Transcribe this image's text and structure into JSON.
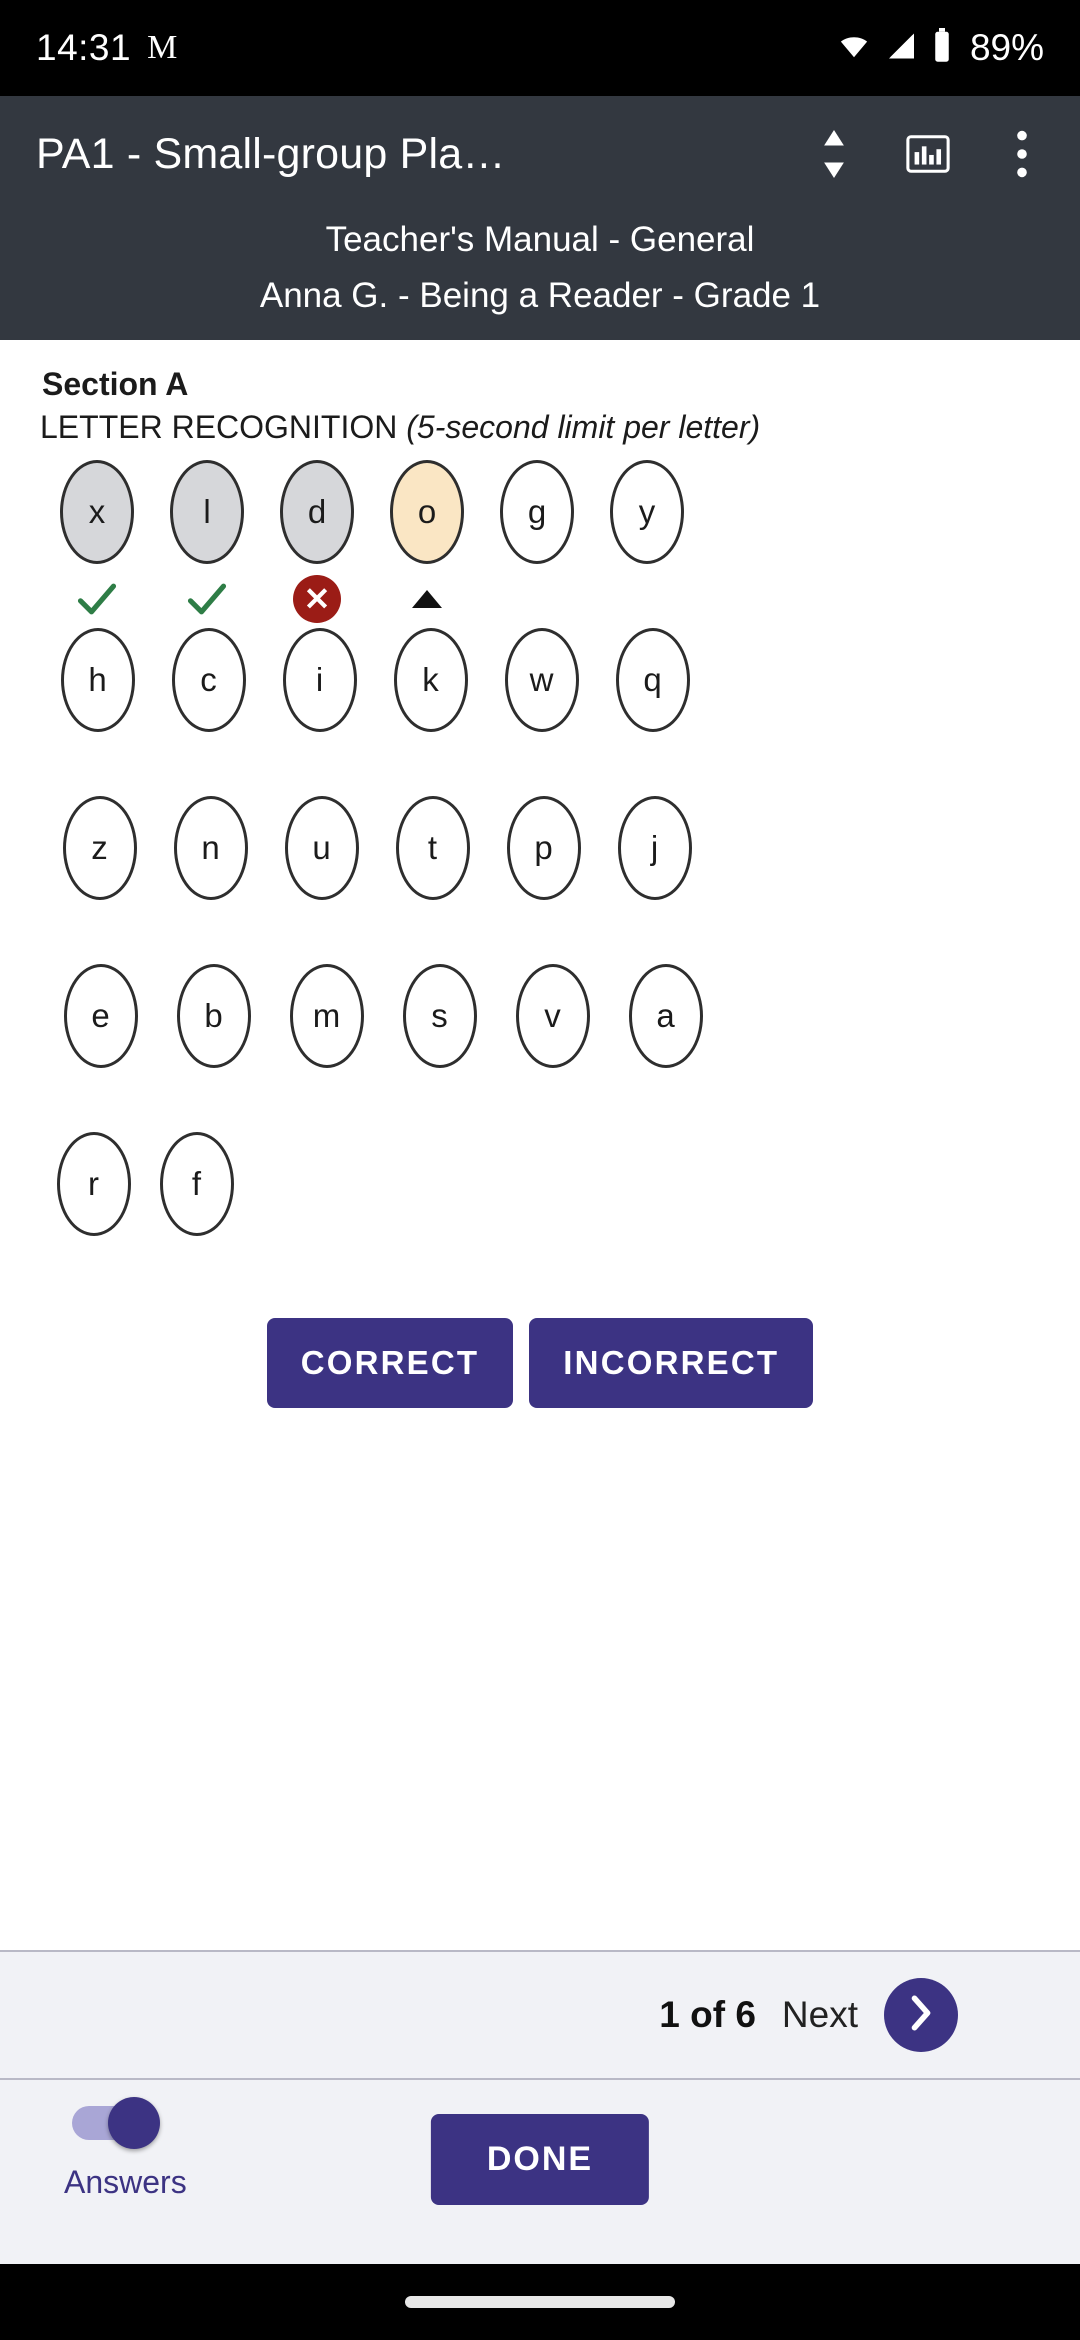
{
  "status_bar": {
    "time": "14:31",
    "notification_icon": "gmail-icon",
    "notification_glyph": "M",
    "wifi_icon": "wifi-icon",
    "signal_icon": "cellular-signal-icon",
    "battery_icon": "battery-icon",
    "battery_percent": "89%"
  },
  "app_bar": {
    "title": "PA1 - Small-group Pla…",
    "sort_icon": "up-down-arrows-icon",
    "chart_icon": "bar-chart-icon",
    "overflow_icon": "more-vertical-icon",
    "subtitle_1": "Teacher's Manual - General",
    "subtitle_2": "Anna  G. - Being a Reader - Grade 1"
  },
  "section": {
    "label": "Section A",
    "task_name": "LETTER RECOGNITION",
    "task_note": "(5-second limit per letter)"
  },
  "letters": {
    "rows": [
      [
        {
          "letter": "x",
          "state": "done",
          "mark": "correct"
        },
        {
          "letter": "l",
          "state": "done",
          "mark": "correct"
        },
        {
          "letter": "d",
          "state": "done",
          "mark": "incorrect"
        },
        {
          "letter": "o",
          "state": "current",
          "mark": "pointer"
        },
        {
          "letter": "g",
          "state": "pending",
          "mark": "none"
        },
        {
          "letter": "y",
          "state": "pending",
          "mark": "none"
        }
      ],
      [
        {
          "letter": "h",
          "state": "pending",
          "mark": "none"
        },
        {
          "letter": "c",
          "state": "pending",
          "mark": "none"
        },
        {
          "letter": "i",
          "state": "pending",
          "mark": "none"
        },
        {
          "letter": "k",
          "state": "pending",
          "mark": "none"
        },
        {
          "letter": "w",
          "state": "pending",
          "mark": "none"
        },
        {
          "letter": "q",
          "state": "pending",
          "mark": "none"
        }
      ],
      [
        {
          "letter": "z",
          "state": "pending",
          "mark": "none"
        },
        {
          "letter": "n",
          "state": "pending",
          "mark": "none"
        },
        {
          "letter": "u",
          "state": "pending",
          "mark": "none"
        },
        {
          "letter": "t",
          "state": "pending",
          "mark": "none"
        },
        {
          "letter": "p",
          "state": "pending",
          "mark": "none"
        },
        {
          "letter": "j",
          "state": "pending",
          "mark": "none"
        }
      ],
      [
        {
          "letter": "e",
          "state": "pending",
          "mark": "none"
        },
        {
          "letter": "b",
          "state": "pending",
          "mark": "none"
        },
        {
          "letter": "m",
          "state": "pending",
          "mark": "none"
        },
        {
          "letter": "s",
          "state": "pending",
          "mark": "none"
        },
        {
          "letter": "v",
          "state": "pending",
          "mark": "none"
        },
        {
          "letter": "a",
          "state": "pending",
          "mark": "none"
        }
      ],
      [
        {
          "letter": "r",
          "state": "pending",
          "mark": "none"
        },
        {
          "letter": "f",
          "state": "pending",
          "mark": "none"
        }
      ]
    ]
  },
  "answer_buttons": {
    "correct_label": "CORRECT",
    "incorrect_label": "INCORRECT"
  },
  "pager": {
    "count": "1 of 6",
    "next_label": "Next",
    "next_icon": "chevron-right-icon"
  },
  "bottom_bar": {
    "toggle_label": "Answers",
    "toggle_state": "on",
    "done_label": "DONE"
  },
  "colors": {
    "accent": "#3c3383",
    "appbar_bg": "#333840",
    "done_fill": "#d6d7da",
    "current_fill": "#fae6c4",
    "correct_green": "#2e7d46",
    "incorrect_red": "#9b1c16",
    "pager_bg": "#f1f2f6"
  }
}
